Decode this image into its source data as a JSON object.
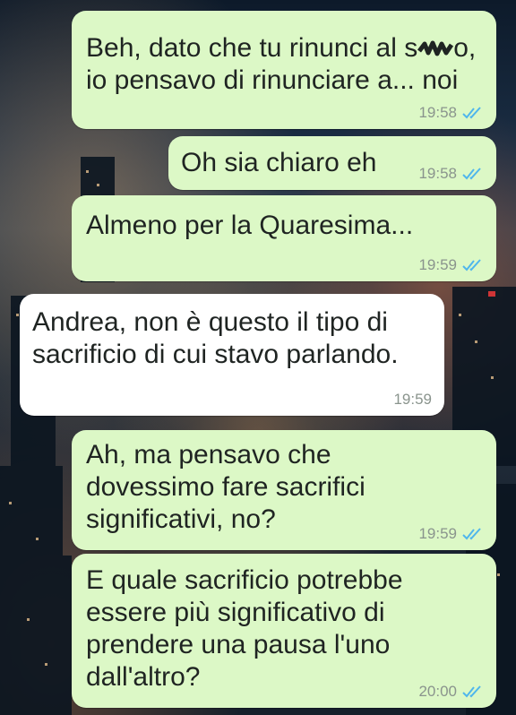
{
  "chat": {
    "messages": [
      {
        "direction": "outgoing",
        "text_before": "Beh, dato che tu rinunci al s",
        "text_after": "o, io pensavo di rinunciare a... noi",
        "time": "19:58",
        "status": "read"
      },
      {
        "direction": "outgoing",
        "text": "Oh sia chiaro eh",
        "time": "19:58",
        "status": "read"
      },
      {
        "direction": "outgoing",
        "text": "Almeno per la Quaresima...",
        "time": "19:59",
        "status": "read"
      },
      {
        "direction": "incoming",
        "text": "Andrea, non è questo il tipo di sacrificio di cui stavo parlando.",
        "time": "19:59"
      },
      {
        "direction": "outgoing",
        "text": "Ah, ma pensavo che dovessimo fare sacrifici significativi, no?",
        "time": "19:59",
        "status": "read"
      },
      {
        "direction": "outgoing",
        "text": "E quale sacrificio potrebbe essere più significativo di prendere una pausa l'uno dall'altro?",
        "time": "20:00",
        "status": "read"
      }
    ]
  },
  "colors": {
    "outgoing_bubble": "#dcf8c6",
    "incoming_bubble": "#ffffff",
    "read_ticks": "#4fb6ec",
    "timestamp": "#8a948d"
  },
  "icons": {
    "read_receipt": "double-check-icon",
    "redaction": "scribble-redaction"
  }
}
